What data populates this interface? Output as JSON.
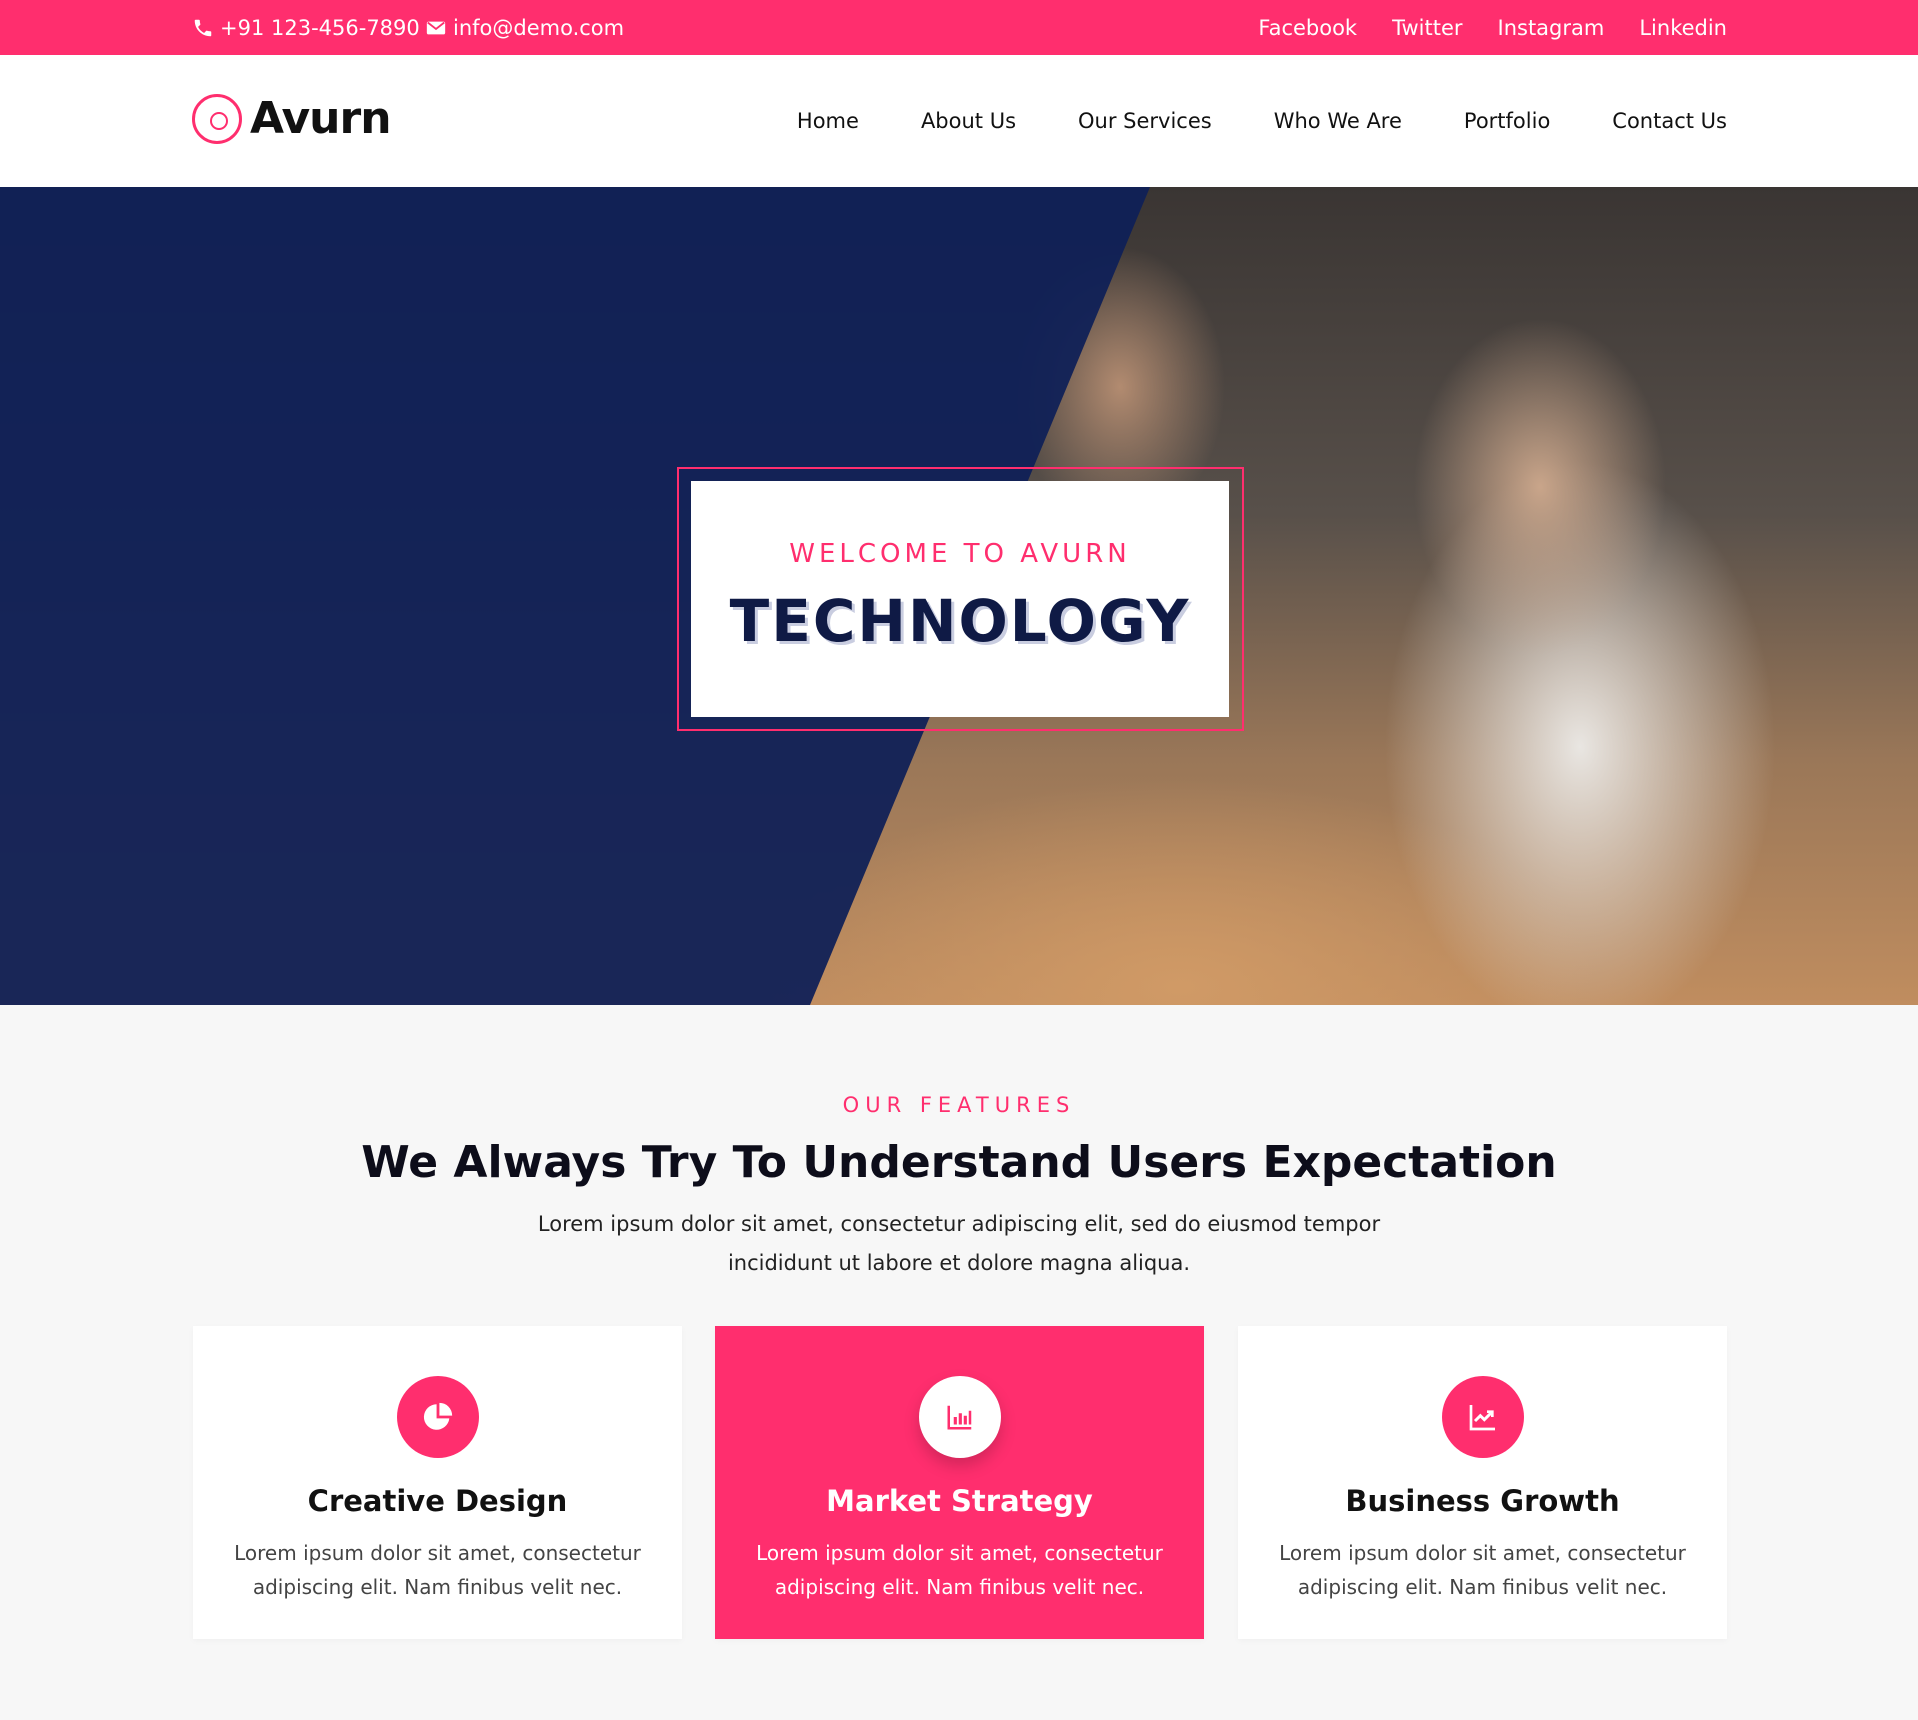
{
  "topbar": {
    "phone": "+91 123-456-7890",
    "email": "info@demo.com",
    "social": [
      "Facebook",
      "Twitter",
      "Instagram",
      "Linkedin"
    ]
  },
  "header": {
    "logo_text": "Avurn",
    "nav": [
      "Home",
      "About Us",
      "Our Services",
      "Who We Are",
      "Portfolio",
      "Contact Us"
    ]
  },
  "hero": {
    "kicker": "WELCOME TO AVURN",
    "title": "TECHNOLOGY"
  },
  "features": {
    "kicker": "OUR FEATURES",
    "title": "We Always Try To Understand Users Expectation",
    "description_line1": "Lorem ipsum dolor sit amet, consectetur adipiscing elit, sed do eiusmod tempor",
    "description_line2": "incididunt ut labore et dolore magna aliqua.",
    "cards": [
      {
        "title": "Creative Design",
        "icon": "pie-chart-icon",
        "line1": "Lorem ipsum dolor sit amet, consectetur",
        "line2": "adipiscing elit. Nam finibus velit nec."
      },
      {
        "title": "Market Strategy",
        "icon": "bar-chart-icon",
        "line1": "Lorem ipsum dolor sit amet, consectetur",
        "line2": "adipiscing elit. Nam finibus velit nec."
      },
      {
        "title": "Business Growth",
        "icon": "line-chart-icon",
        "line1": "Lorem ipsum dolor sit amet, consectetur",
        "line2": "adipiscing elit. Nam finibus velit nec."
      }
    ]
  },
  "colors": {
    "accent": "#ff2e6e",
    "navy": "#0f2057",
    "heading": "#0f1a45"
  }
}
